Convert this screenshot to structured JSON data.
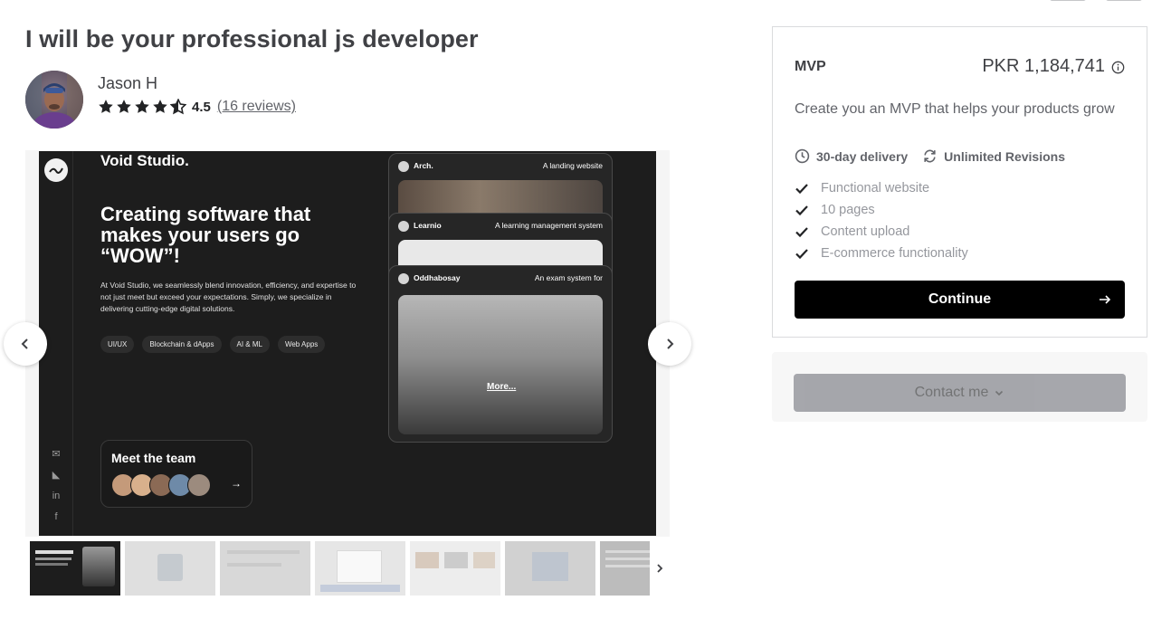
{
  "gig": {
    "title": "I will be your professional js developer"
  },
  "seller": {
    "name": "Jason H",
    "rating": "4.5",
    "reviews_link": "(16 reviews)",
    "stars_filled": 4.5
  },
  "gallery": {
    "slide": {
      "brand": "Void Studio.",
      "headline": "Creating software that makes your users go “WOW”!",
      "body": "At Void Studio, we seamlessly blend innovation, efficiency, and expertise to not just meet but exceed your expectations. Simply, we specialize in delivering cutting-edge digital solutions.",
      "tags": [
        "UI/UX",
        "Blockchain & dApps",
        "AI & ML",
        "Web Apps"
      ],
      "team_title": "Meet the team",
      "projects": [
        {
          "name": "Arch.",
          "desc": "A landing website"
        },
        {
          "name": "Learnio",
          "desc": "A learning management system"
        },
        {
          "name": "Oddhabosay",
          "desc": "An exam system for"
        }
      ],
      "more_link": "More..."
    },
    "thumbnail_count": 7,
    "prev_icon": "chevron-left-icon",
    "next_icon": "chevron-right-icon"
  },
  "package": {
    "name": "MVP",
    "price": "PKR 1,184,741",
    "description": "Create you an MVP that helps your products grow",
    "delivery": "30-day delivery",
    "revisions": "Unlimited Revisions",
    "features": [
      "Functional website",
      "10 pages",
      "Content upload",
      "E-commerce functionality"
    ],
    "continue_label": "Continue"
  },
  "contact": {
    "label": "Contact me"
  },
  "colors": {
    "primary_button": "#000000",
    "star": "#222325",
    "text_muted": "#95979d",
    "contact_button": "#74767e"
  }
}
